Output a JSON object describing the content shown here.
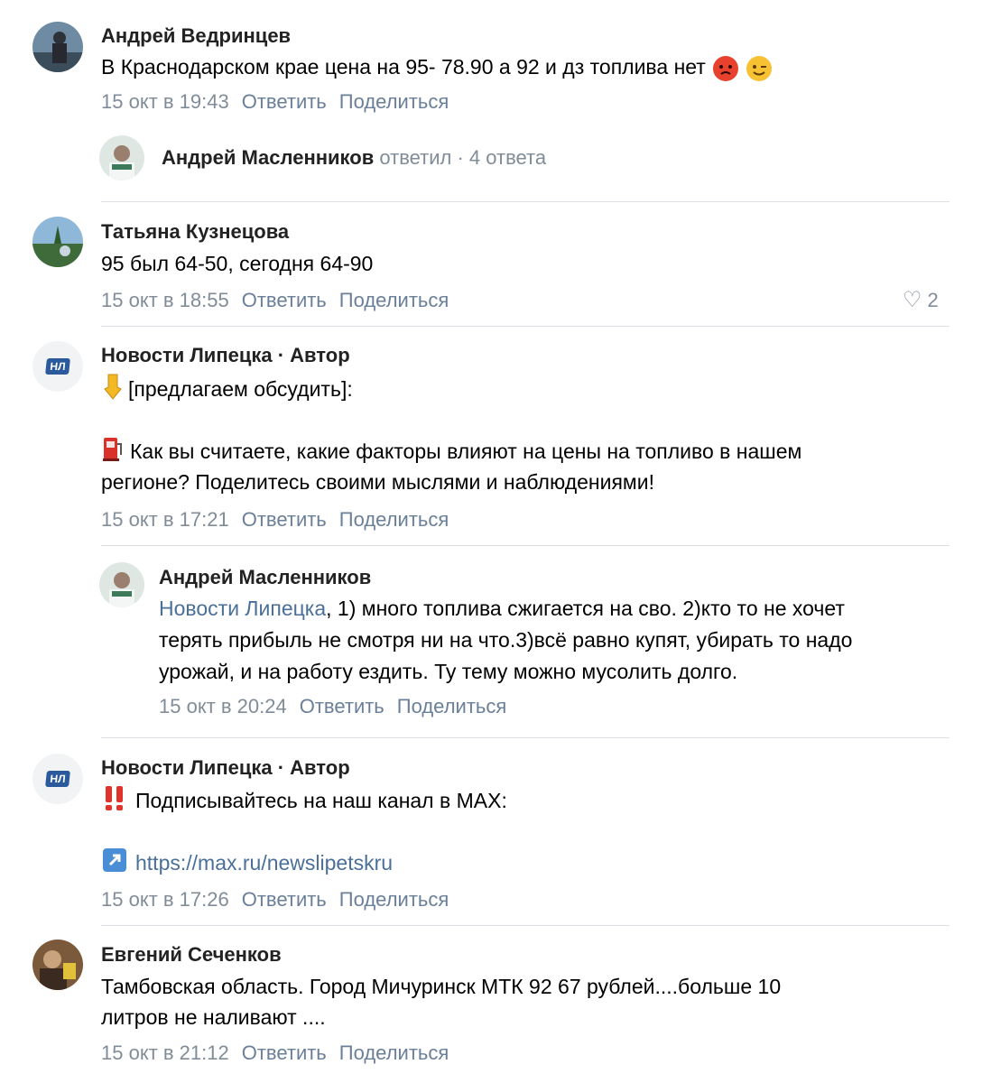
{
  "comments": [
    {
      "author": "Андрей Ведринцев",
      "text": "В Краснодарском крае цена на 95- 78.90 а 92 и дз топлива нет",
      "emojis": [
        "angry-face-icon",
        "winking-face-icon"
      ],
      "date": "15 окт в 19:43",
      "reply_label": "Ответить",
      "share_label": "Поделиться",
      "thread": {
        "author": "Андрей Масленников",
        "replied_label": "ответил",
        "separator": "·",
        "count_label": "4 ответа"
      }
    },
    {
      "author": "Татьяна Кузнецова",
      "text": "95 был 64-50, сегодня 64-90",
      "date": "15 окт в 18:55",
      "reply_label": "Ответить",
      "share_label": "Поделиться",
      "likes": "2"
    },
    {
      "author": "Новости Липецка · Автор",
      "avatar_label": "НЛ",
      "line1": "[предлагаем обсудить]:",
      "line2": "Как вы считаете, какие факторы влияют на цены на топливо в нашем",
      "line3": "регионе? Поделитесь своими мыслями и наблюдениями!",
      "date": "15 окт в 17:21",
      "reply_label": "Ответить",
      "share_label": "Поделиться",
      "reply": {
        "author": "Андрей Масленников",
        "mention": "Новости Липецка",
        "line1": ", 1) много топлива сжигается на сво. 2)кто то не хочет",
        "line2": "терять прибыль не смотря ни на что.3)всё равно купят, убирать то надо",
        "line3": "урожай, и на работу ездить. Ту тему можно мусолить долго.",
        "date": "15 окт в 20:24",
        "reply_label": "Ответить",
        "share_label": "Поделиться"
      }
    },
    {
      "author": "Новости Липецка · Автор",
      "avatar_label": "НЛ",
      "line1": "Подписывайтесь на наш канал в MAX:",
      "link": "https://max.ru/newslipetskru",
      "date": "15 окт в 17:26",
      "reply_label": "Ответить",
      "share_label": "Поделиться"
    },
    {
      "author": "Евгений Сеченков",
      "line1": "Тамбовская область. Город Мичуринск МТК 92 67 рублей....больше 10",
      "line2": "литров не наливают ....",
      "date": "15 окт в 21:12",
      "reply_label": "Ответить",
      "share_label": "Поделиться"
    }
  ],
  "colors": {
    "author": "#222222",
    "meta": "#818c99",
    "action": "#6a7f99",
    "link": "#4a6f99",
    "divider": "#dcdfe3",
    "badge": "#2a5a9c"
  }
}
